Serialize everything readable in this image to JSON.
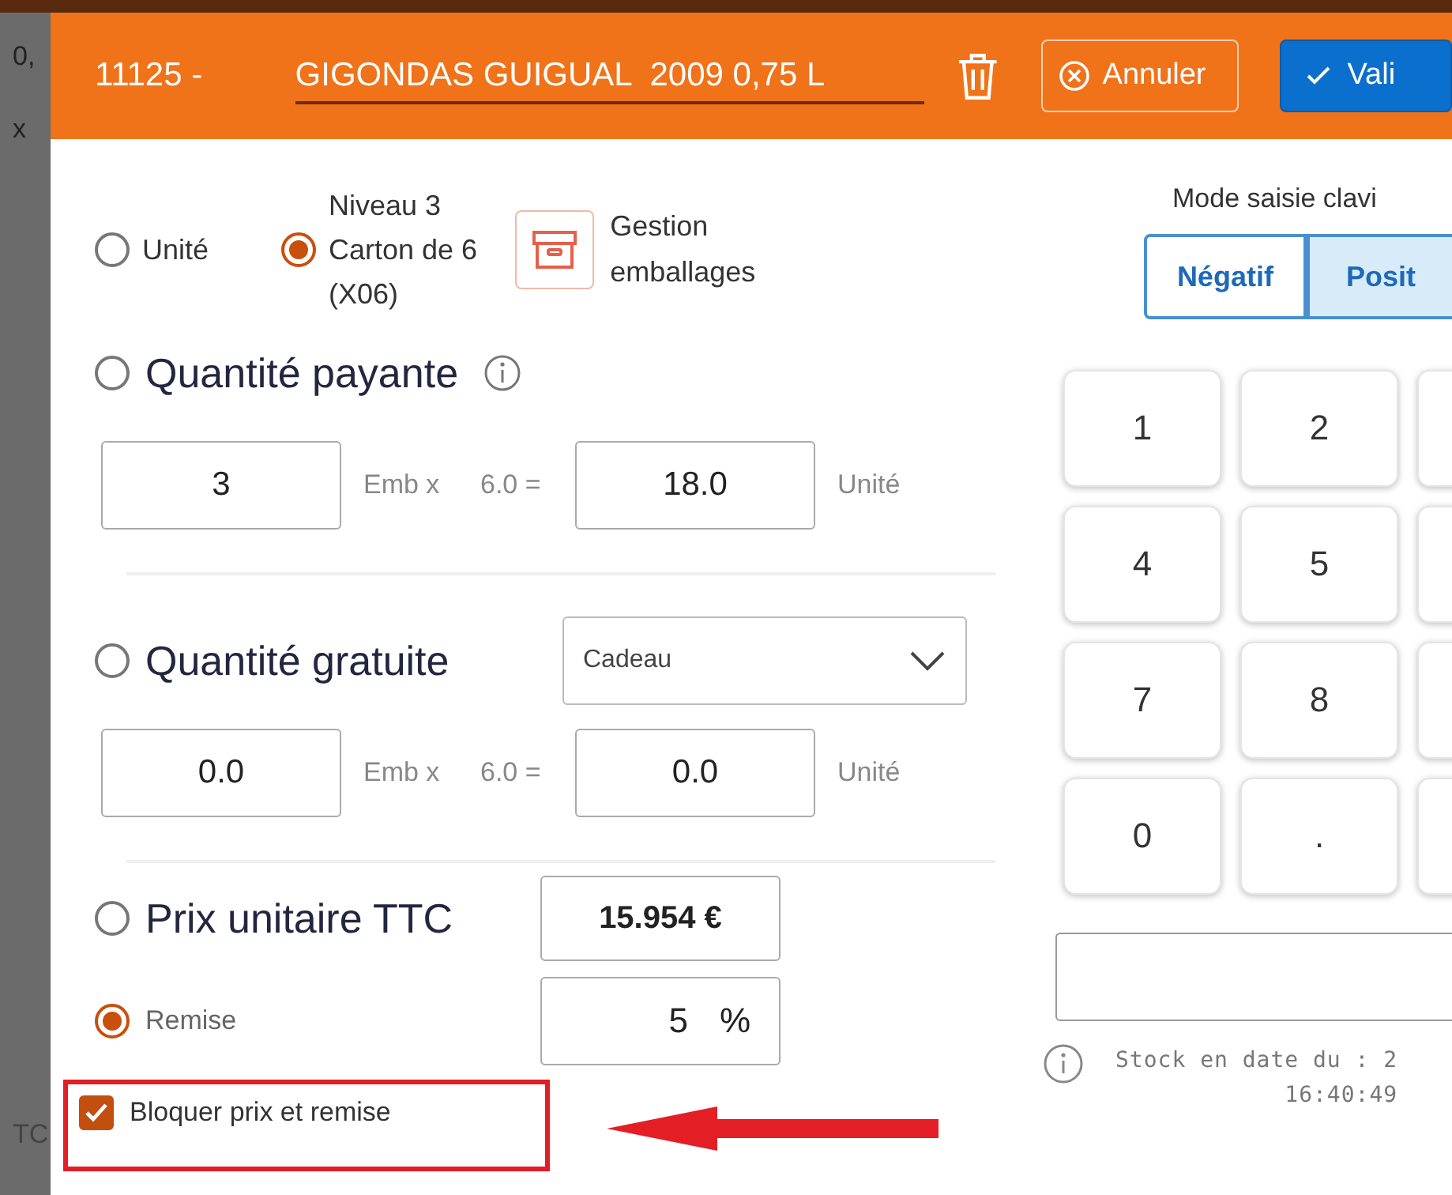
{
  "backdrop_texts": [
    "0,",
    "x",
    "TC"
  ],
  "header": {
    "code": "11125 -",
    "title": "GIGONDAS GUIGUAL  2009 0,75 L",
    "buttons": [
      {
        "label": "Annuler",
        "kind": "cancel"
      },
      {
        "label": "Vali",
        "kind": "validate"
      }
    ]
  },
  "packaging": {
    "options": [
      {
        "lines": [
          "Unité"
        ],
        "selected": false
      },
      {
        "lines": [
          "Niveau 3",
          "Carton de 6",
          "(X06)"
        ],
        "selected": true
      }
    ],
    "manage_button": [
      "Gestion",
      "emballages"
    ]
  },
  "paid_quantity": {
    "label": "Quantité payante",
    "selected": false,
    "packages": "3",
    "packages_label": "Emb x",
    "factor": "6.0 =",
    "units": "18.0",
    "units_label": "Unité"
  },
  "free_quantity": {
    "label": "Quantité gratuite",
    "selected": false,
    "reason": "Cadeau",
    "packages": "0.0",
    "packages_label": "Emb x",
    "factor": "6.0 =",
    "units": "0.0",
    "units_label": "Unité"
  },
  "unit_price": {
    "label": "Prix unitaire TTC",
    "selected": false,
    "value": "15.954 €"
  },
  "discount": {
    "label": "Remise",
    "selected": true,
    "value": "5",
    "unit": "%"
  },
  "lock": {
    "label": "Bloquer prix et remise",
    "checked": true
  },
  "keyboard_mode": {
    "label": "Mode saisie clavi",
    "options": [
      {
        "label": "Négatif",
        "selected": false
      },
      {
        "label": "Posit",
        "selected": true
      }
    ]
  },
  "keypad": {
    "rows": [
      [
        "1",
        "2"
      ],
      [
        "4",
        "5"
      ],
      [
        "7",
        "8"
      ],
      [
        "0",
        "."
      ]
    ]
  },
  "stock_info": {
    "lines": [
      "Stock en date du : 2",
      "16:40:49"
    ]
  }
}
